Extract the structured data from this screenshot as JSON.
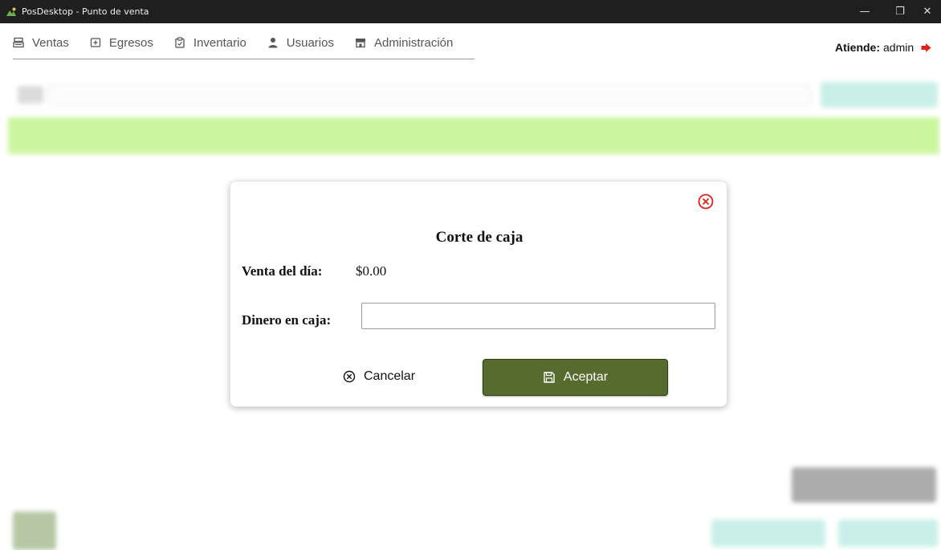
{
  "window": {
    "title": "PosDesktop - Punto de venta",
    "min_glyph": "—",
    "max_glyph": "❐",
    "close_glyph": "✕"
  },
  "nav": {
    "items": [
      {
        "label": "Ventas",
        "icon": "cash-register-icon"
      },
      {
        "label": "Egresos",
        "icon": "cash-out-icon"
      },
      {
        "label": "Inventario",
        "icon": "clipboard-icon"
      },
      {
        "label": "Usuarios",
        "icon": "user-icon"
      },
      {
        "label": "Administración",
        "icon": "store-icon"
      }
    ]
  },
  "user": {
    "label": "Atiende:",
    "name": "admin",
    "logout_icon": "logout-icon"
  },
  "modal": {
    "title": "Corte de caja",
    "sales_label": "Venta del día:",
    "sales_value": "$0.00",
    "cash_label": "Dinero en caja:",
    "cash_value": "",
    "cancel_label": "Cancelar",
    "accept_label": "Aceptar"
  },
  "colors": {
    "accent_green": "#566b2e",
    "close_red": "#e0201b",
    "table_header": "#a4ee52",
    "teal_button": "#9fe3d7"
  }
}
